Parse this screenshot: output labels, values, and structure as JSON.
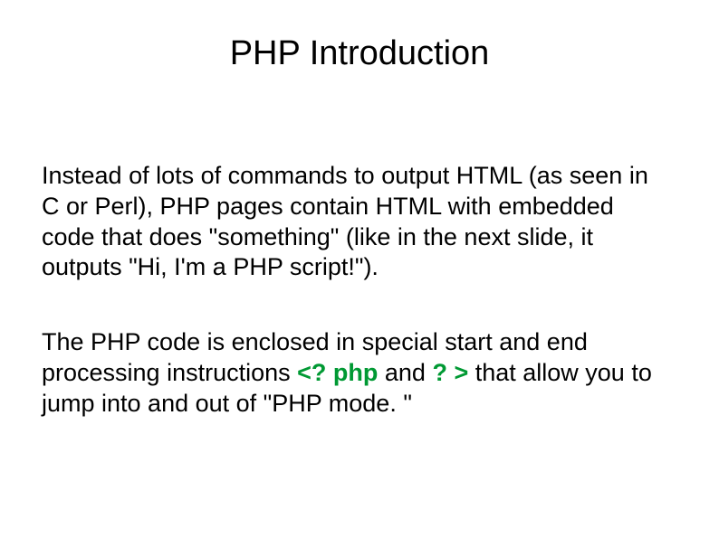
{
  "slide": {
    "title": "PHP Introduction",
    "paragraph1": "Instead of lots of commands to output HTML (as seen in C or Perl), PHP pages contain HTML with embedded code that does \"something\" (like in the next slide, it outputs \"Hi, I'm a PHP script!\").",
    "paragraph2_part1": "The PHP code is enclosed in special start and end processing instructions ",
    "paragraph2_code1": "<? php",
    "paragraph2_and": " and ",
    "paragraph2_code2": "? >",
    "paragraph2_part2": "  that allow you to jump into and out of \"PHP mode. \""
  }
}
